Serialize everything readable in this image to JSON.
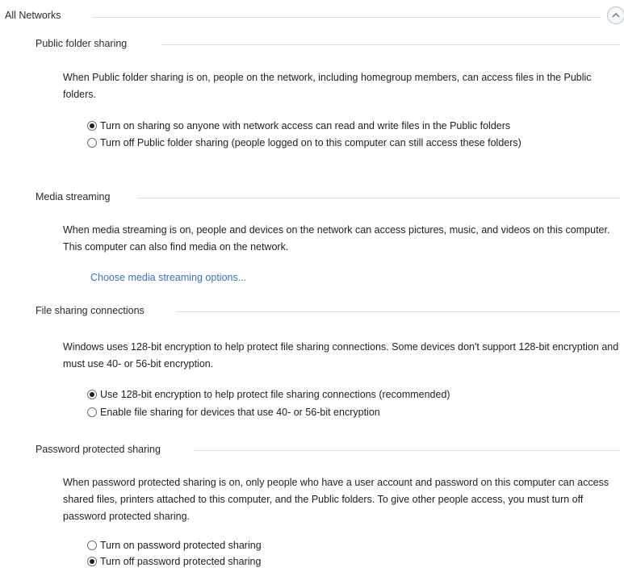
{
  "group": {
    "title": "All Networks",
    "collapse_icon": "chevron-up-icon"
  },
  "sections": {
    "public_folder": {
      "title": "Public folder sharing",
      "description": "When Public folder sharing is on, people on the network, including homegroup members, can access files in the Public folders.",
      "options": [
        {
          "label": "Turn on sharing so anyone with network access can read and write files in the Public folders",
          "selected": true
        },
        {
          "label": "Turn off Public folder sharing (people logged on to this computer can still access these folders)",
          "selected": false
        }
      ]
    },
    "media_streaming": {
      "title": "Media streaming",
      "description": "When media streaming is on, people and devices on the network can access pictures, music, and videos on this computer. This computer can also find media on the network.",
      "link": "Choose media streaming options..."
    },
    "file_sharing": {
      "title": "File sharing connections",
      "description": "Windows uses 128-bit encryption to help protect file sharing connections. Some devices don't support 128-bit encryption and must use 40- or 56-bit encryption.",
      "options": [
        {
          "label": "Use 128-bit encryption to help protect file sharing connections (recommended)",
          "selected": true
        },
        {
          "label": "Enable file sharing for devices that use 40- or 56-bit encryption",
          "selected": false
        }
      ]
    },
    "password_sharing": {
      "title": "Password protected sharing",
      "description": "When password protected sharing is on, only people who have a user account and password on this computer can access shared files, printers attached to this computer, and the Public folders. To give other people access, you must turn off password protected sharing.",
      "options": [
        {
          "label": "Turn on password protected sharing",
          "selected": false
        },
        {
          "label": "Turn off password protected sharing",
          "selected": true
        }
      ]
    }
  }
}
